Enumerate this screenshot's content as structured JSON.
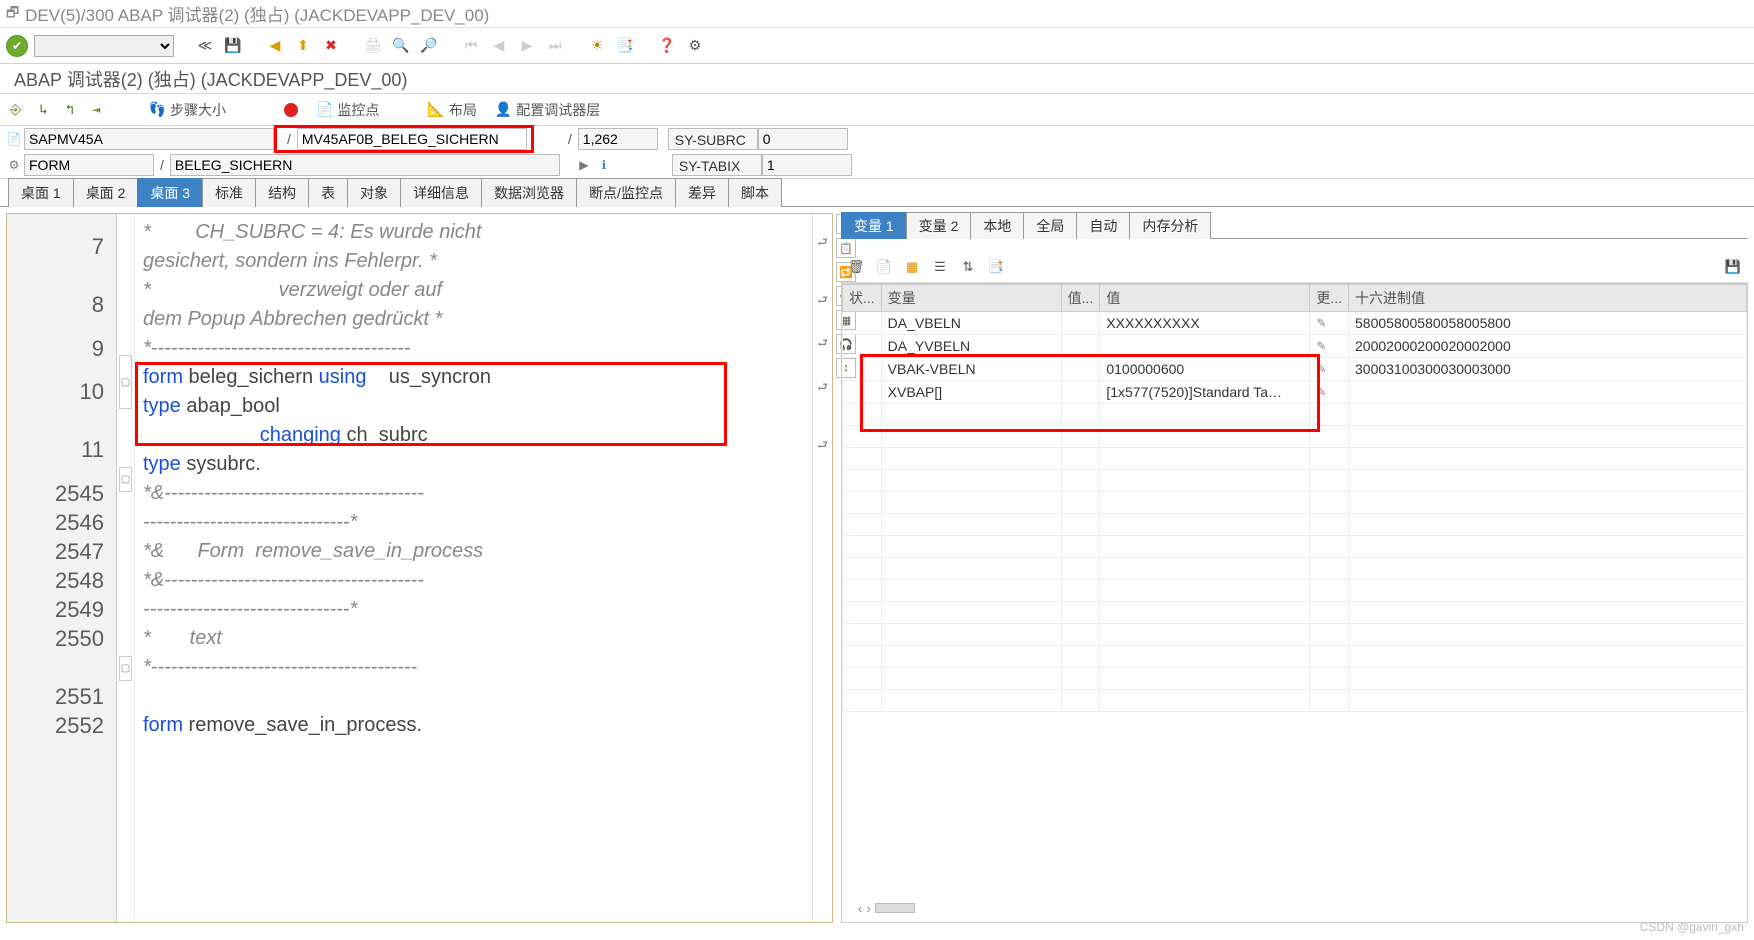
{
  "window": {
    "title": "DEV(5)/300 ABAP 调试器(2)  (独占) (JACKDEVAPP_DEV_00)"
  },
  "subtitle": "ABAP 调试器(2)  (独占) (JACKDEVAPP_DEV_00)",
  "tool2": {
    "step_size_label": "步骤大小",
    "watchpoint_label": "监控点",
    "layout_label": "布局",
    "config_label": "配置调试器层"
  },
  "fields": {
    "program": "SAPMV45A",
    "include": "MV45AF0B_BELEG_SICHERN",
    "line": "1,262",
    "subrc_label": "SY-SUBRC",
    "subrc_value": "0",
    "type_label": "FORM",
    "routine": "BELEG_SICHERN",
    "tabix_label": "SY-TABIX",
    "tabix_value": "1"
  },
  "tabs": [
    "桌面 1",
    "桌面 2",
    "桌面 3",
    "标准",
    "结构",
    "表",
    "对象",
    "详细信息",
    "数据浏览器",
    "断点/监控点",
    "差异",
    "脚本"
  ],
  "active_tab": 2,
  "code": {
    "gutter": [
      "7",
      "8",
      "9",
      "10",
      "11",
      "2545",
      "2546",
      "2547",
      "2548",
      "2549",
      "2550",
      "2551",
      "2552"
    ],
    "lines": [
      {
        "t": "cmt",
        "text": "*        CH_SUBRC = 4: Es wurde nicht gesichert, sondern ins Fehlerpr. *"
      },
      {
        "t": "cmt",
        "text": "*                       verzweigt oder auf dem Popup Abbrechen gedrückt *"
      },
      {
        "t": "cmt",
        "text": "*----------------------------------------------------------------------*"
      },
      {
        "t": "code",
        "html": "<span class='kw'>form</span> <span class='id'>beleg_sichern</span> <span class='kw'>using</span>    us_syncron <span class='kw'>type</span> abap_bool"
      },
      {
        "t": "code",
        "html": "                     <span class='kw'>changing</span> ch_subrc   <span class='kw'>type</span> sysubrc."
      },
      {
        "t": "cmt",
        "text": "*&---------------------------------------------------------------------*"
      },
      {
        "t": "cmt",
        "text": "*&      Form  remove_save_in_process"
      },
      {
        "t": "cmt",
        "text": "*&---------------------------------------------------------------------*"
      },
      {
        "t": "cmt",
        "text": "*       text"
      },
      {
        "t": "cmt",
        "text": "*----------------------------------------------------------------------*"
      },
      {
        "t": "code",
        "html": "<span class='kw'>form</span> remove_save_in_process."
      }
    ]
  },
  "var_tabs": [
    "变量 1",
    "变量 2",
    "本地",
    "全局",
    "自动",
    "内存分析"
  ],
  "var_active": 0,
  "var_headers": {
    "status": "状...",
    "name": "变量",
    "val_short": "值...",
    "value": "值",
    "chg": "更...",
    "hex": "十六进制值"
  },
  "variables": [
    {
      "name": "DA_VBELN",
      "value": "XXXXXXXXXX",
      "hex": "58005800580058005800"
    },
    {
      "name": "DA_YVBELN",
      "value": "",
      "hex": "20002000200020002000"
    },
    {
      "name": "VBAK-VBELN",
      "value": "0100000600",
      "hex": "30003100300030003000"
    },
    {
      "name": "XVBAP[]",
      "value": "[1x577(7520)]Standard Ta…",
      "hex": ""
    }
  ],
  "watermark": "CSDN @gavin_gxh"
}
